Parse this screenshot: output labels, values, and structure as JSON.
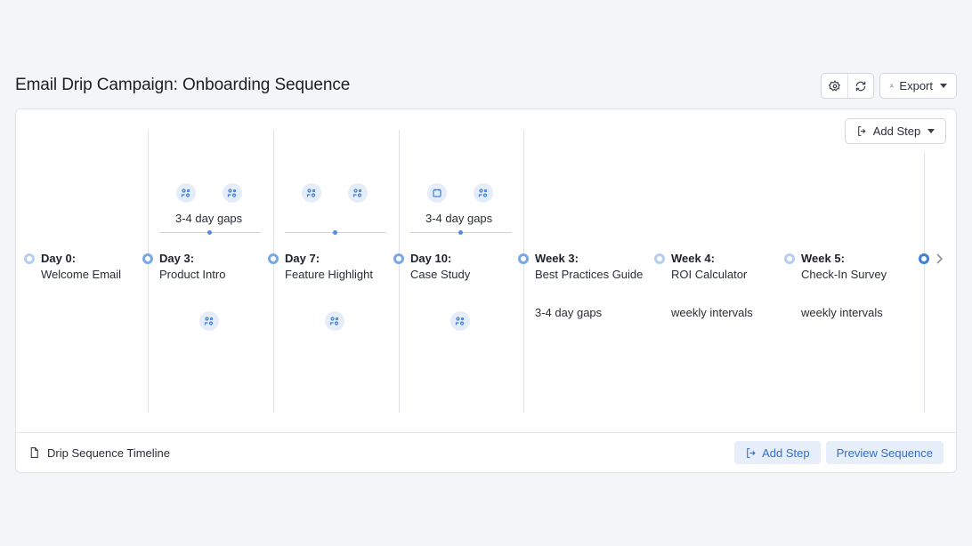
{
  "page": {
    "title": "Email Drip Campaign: Onboarding Sequence"
  },
  "toolbar": {
    "export_label": "Export",
    "settings_icon": "gear-icon",
    "refresh_icon": "refresh-icon"
  },
  "timeline": {
    "add_step_label": "Add Step",
    "steps": [
      {
        "title": "Day 0:",
        "subtitle": "Welcome Email"
      },
      {
        "title": "Day 3:",
        "subtitle": "Product Intro"
      },
      {
        "title": "Day 7:",
        "subtitle": "Feature Highlight"
      },
      {
        "title": "Day 10:",
        "subtitle": "Case Study"
      },
      {
        "title": "Week 3:",
        "subtitle": "Best Practices Guide",
        "note": "3-4 day gaps"
      },
      {
        "title": "Week 4:",
        "subtitle": "ROI Calculator",
        "note": "weekly intervals"
      },
      {
        "title": "Week 5:",
        "subtitle": "Check-In Survey",
        "note": "weekly intervals"
      }
    ],
    "gap_labels": [
      "3-4 day gaps",
      "3-4 day gaps"
    ]
  },
  "footer": {
    "label": "Drip Sequence Timeline",
    "add_step_label": "Add Step",
    "preview_label": "Preview Sequence"
  },
  "colors": {
    "accent": "#2f6fcf",
    "soft_accent_bg": "#e6eef9"
  }
}
